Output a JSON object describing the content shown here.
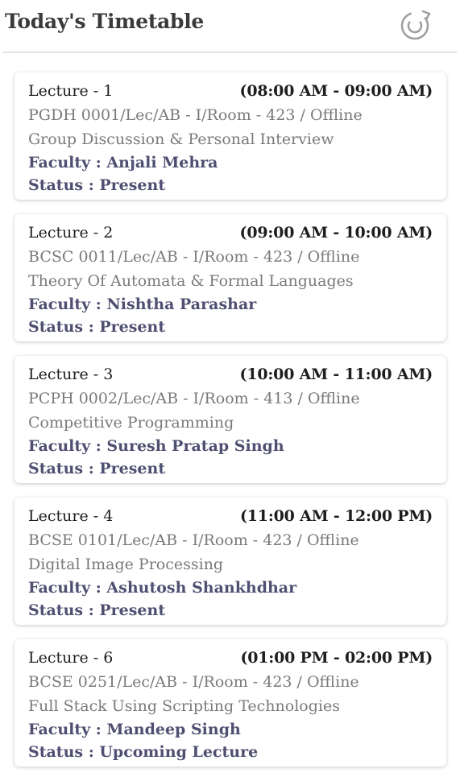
{
  "header": {
    "title": "Today's Timetable",
    "refresh_icon": "refresh-icon"
  },
  "colors": {
    "faculty_text": "#4f4f72",
    "secondary_text": "#7a7a7a",
    "divider": "#e2e2e2",
    "icon": "#9e9e9e"
  },
  "lectures": [
    {
      "label": "Lecture - 1",
      "time": "(08:00 AM - 09:00 AM)",
      "code": "PGDH 0001/Lec/AB - I/Room - 423 / Offline",
      "subject": "Group Discussion & Personal Interview",
      "faculty": "Faculty : Anjali Mehra",
      "status": "Status : Present"
    },
    {
      "label": "Lecture - 2",
      "time": "(09:00 AM - 10:00 AM)",
      "code": "BCSC 0011/Lec/AB - I/Room - 423 / Offline",
      "subject": "Theory Of Automata & Formal Languages",
      "faculty": "Faculty : Nishtha Parashar",
      "status": "Status : Present"
    },
    {
      "label": "Lecture - 3",
      "time": "(10:00 AM - 11:00 AM)",
      "code": "PCPH 0002/Lec/AB - I/Room - 413 / Offline",
      "subject": "Competitive Programming",
      "faculty": "Faculty : Suresh Pratap Singh",
      "status": "Status : Present"
    },
    {
      "label": "Lecture - 4",
      "time": "(11:00 AM - 12:00 PM)",
      "code": "BCSE 0101/Lec/AB - I/Room - 423 / Offline",
      "subject": "Digital Image Processing",
      "faculty": "Faculty : Ashutosh Shankhdhar",
      "status": "Status : Present"
    },
    {
      "label": "Lecture - 6",
      "time": "(01:00 PM - 02:00 PM)",
      "code": "BCSE 0251/Lec/AB - I/Room - 423 / Offline",
      "subject": "Full Stack Using Scripting Technologies",
      "faculty": "Faculty : Mandeep Singh",
      "status": "Status : Upcoming Lecture"
    }
  ]
}
